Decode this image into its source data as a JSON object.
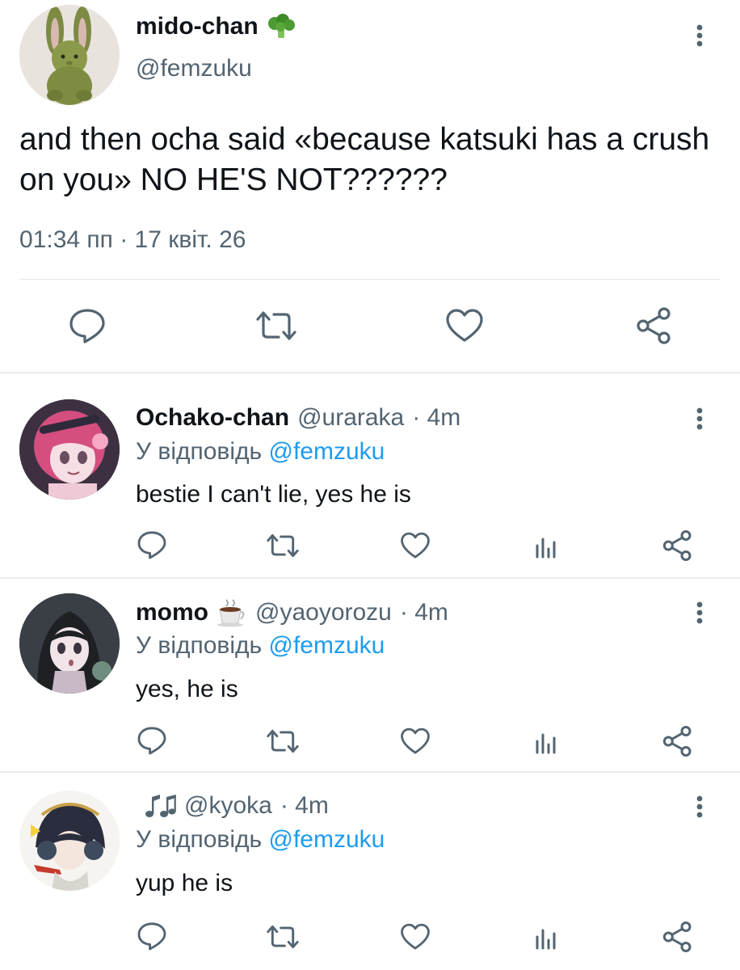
{
  "main_tweet": {
    "display_name": "mido-chan",
    "name_emoji": "broccoli",
    "handle": "@femzuku",
    "text": "and then ocha said «because katsuki has a crush on you» NO HE'S NOT??????",
    "timestamp": "01:34 пп · 17 квіт. 26"
  },
  "replies": [
    {
      "display_name": "Ochako-chan",
      "name_emoji": "",
      "handle": "@uraraka",
      "time": "· 4m",
      "reply_prefix": "У відповідь ",
      "reply_mention": "@femzuku",
      "text": "bestie I can't lie, yes he is"
    },
    {
      "display_name": "momo",
      "name_emoji": "coffee",
      "handle": "@yaoyorozu",
      "time": "· 4m",
      "reply_prefix": "У відповідь ",
      "reply_mention": "@femzuku",
      "text": "yes, he is"
    },
    {
      "display_name": "",
      "name_emoji": "music-notes",
      "handle": "@kyoka",
      "time": "· 4m",
      "reply_prefix": "У відповідь ",
      "reply_mention": "@femzuku",
      "text": "yup he is"
    }
  ],
  "colors": {
    "text_primary": "#0f1419",
    "text_secondary": "#536471",
    "accent": "#1d9bf0",
    "divider": "#e1e6ea"
  },
  "icons": {
    "reply": "comment-icon",
    "retweet": "retweet-icon",
    "like": "heart-icon",
    "views": "views-icon",
    "share": "share-icon",
    "more": "more-vertical-icon"
  }
}
